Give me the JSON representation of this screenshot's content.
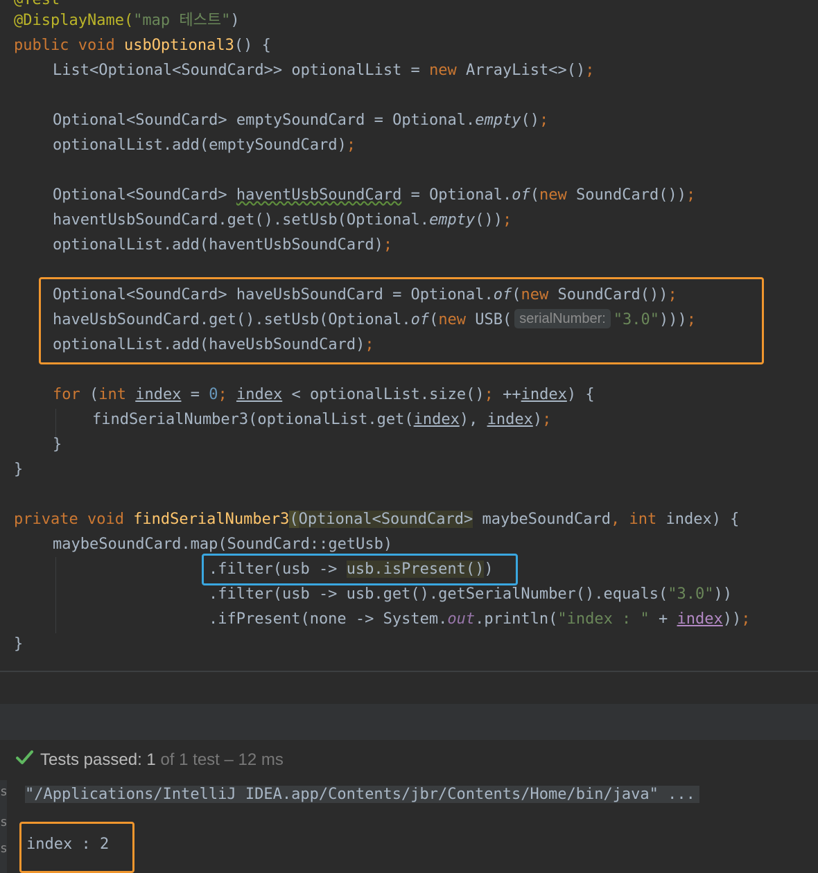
{
  "editor": {
    "line0": "@Test",
    "annotation": "@DisplayName(",
    "display_name_str": "\"map 테스트\"",
    "close_paren": ")",
    "method1_kw": "public void ",
    "method1_name": "usbOptional3",
    "method1_rest": "() {",
    "l1": "List<Optional<SoundCard>> optionalList = ",
    "l1_kw": "new",
    "l1_rest": " ArrayList<>()",
    "semi": ";",
    "l2a": "Optional<SoundCard> emptySoundCard = Optional.",
    "l2_empty": "empty",
    "l2b": "()",
    "l3": "optionalList.add(emptySoundCard)",
    "l4a": "Optional<SoundCard> ",
    "l4_var": "haventUsbSoundCard",
    "l4b": " = Optional.",
    "l4_of": "of",
    "l4c": "(",
    "new_kw": "new",
    "l4d": " SoundCard())",
    "l5a": "haventUsbSoundCard.get().setUsb(Optional.",
    "l5_empty": "empty",
    "l5b": "())",
    "l6": "optionalList.add(haventUsbSoundCard)",
    "l7a": "Optional<SoundCard> haveUsbSoundCard = Optional.",
    "l7_of": "of",
    "l7b": "(",
    "l7c": " SoundCard())",
    "l8a": "haveUsbSoundCard.get().setUsb(Optional.",
    "l8_of": "of",
    "l8b": "(",
    "l8c": " USB(",
    "hint_serial": "serialNumber:",
    "l8_str": "\"3.0\"",
    "l8d": ")))",
    "l9": "optionalList.add(haveUsbSoundCard)",
    "for_kw": "for",
    "for_a": " (",
    "int_kw": "int",
    "index": "index",
    "for_eq": " = ",
    "zero": "0",
    "for_lt": " < optionalList.size()",
    "for_inc": " ++",
    "for_end": ") {",
    "find_call": "findSerialNumber3(optionalList.get(",
    "find_mid": "), ",
    "find_end": ")",
    "close_brace_in": "}",
    "close_brace": "}",
    "m2_kw": "private void ",
    "m2_name": "findSerialNumber3",
    "m2_paren": "(",
    "m2_param_type": "Optional<SoundCard>",
    "m2_param_rest": " maybeSoundCard",
    "m2_comma": ", ",
    "m2_int": "int",
    "m2_end": " index) {",
    "map_line": "maybeSoundCard.map(SoundCard::getUsb)",
    "filter1a": ".filter(usb -> ",
    "filter1b": "usb.isPresent()",
    "filter1c": ")",
    "filter2a": ".filter(usb -> usb.get().getSerialNumber().equals(",
    "filter2_str": "\"3.0\"",
    "filter2b": "))",
    "ifp_a": ".ifPresent(none -> System.",
    "ifp_out": "out",
    "ifp_b": ".println(",
    "ifp_str": "\"index : \"",
    "ifp_plus": " + ",
    "ifp_c": "))"
  },
  "test_status": {
    "passed_label": "Tests passed: ",
    "passed_count": "1",
    "of_total": " of 1 test",
    "duration": " – 12 ms"
  },
  "console": {
    "command": "\"/Applications/IntelliJ IDEA.app/Contents/jbr/Contents/Home/bin/java\" ...",
    "output": "index : 2"
  },
  "colors": {
    "highlight_box": "#f0962e",
    "focus_box": "#3aa7e0",
    "success": "#5fb760"
  }
}
